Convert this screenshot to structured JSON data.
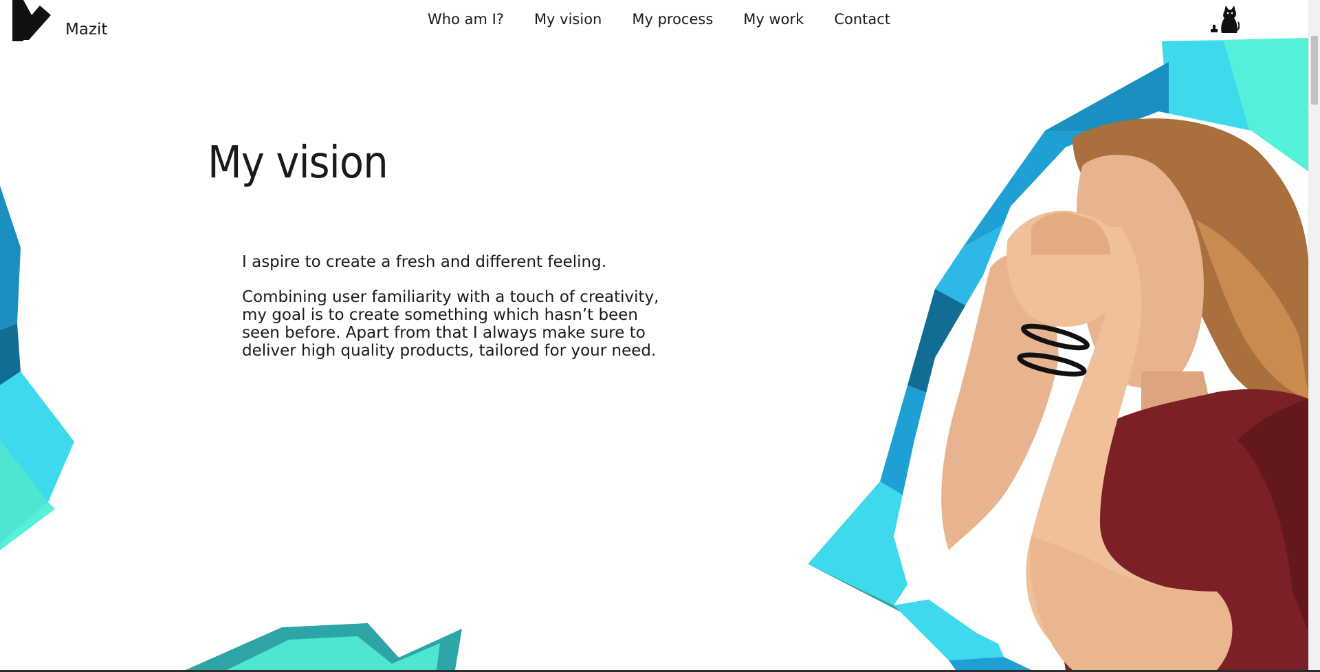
{
  "header": {
    "brand": "Mazit",
    "nav": [
      "Who am I?",
      "My vision",
      "My process",
      "My work",
      "Contact"
    ]
  },
  "icons": {
    "logo": "m-logo-icon",
    "cat": "cat-icon"
  },
  "main": {
    "title": "My vision",
    "paragraphs": [
      "I aspire to create a fresh and different feeling.",
      "Combining user familiarity with a touch of creativity, my goal is to create something which hasn’t been seen before. Apart from that I always make sure to deliver high quality products, tailored for your need."
    ]
  },
  "colors": {
    "accent_cyan": "#3fd9ee",
    "accent_teal": "#4ee6d0",
    "accent_blue": "#1a8fc0",
    "shirt": "#7a2026",
    "skin": "#e8b48f",
    "hair": "#a9703e"
  }
}
